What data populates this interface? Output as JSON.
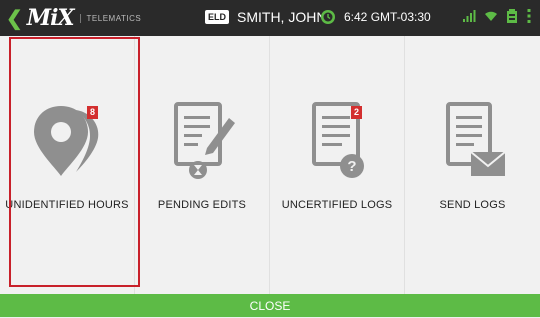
{
  "header": {
    "brand": "MiX",
    "brand_sub": "TELEMATICS",
    "eld_label": "ELD",
    "driver_name": "SMITH, JOHN",
    "time": "6:42 GMT-03:30",
    "status_icon": "clock-icon",
    "system_icons": [
      "signal-icon",
      "wifi-icon",
      "battery-icon",
      "more-icon"
    ]
  },
  "tiles": [
    {
      "label": "UNIDENTIFIED HOURS",
      "badge": "8",
      "icon": "location-pin-icon",
      "selected": true
    },
    {
      "label": "PENDING EDITS",
      "badge": "",
      "icon": "document-edit-icon",
      "selected": false
    },
    {
      "label": "UNCERTIFIED LOGS",
      "badge": "2",
      "icon": "document-question-icon",
      "selected": false
    },
    {
      "label": "SEND LOGS",
      "badge": "",
      "icon": "document-mail-icon",
      "selected": false
    }
  ],
  "footer": {
    "close_label": "CLOSE"
  },
  "colors": {
    "accent": "#5dbb46",
    "badge": "#d32f2f",
    "selection": "#c8202a",
    "icon": "#8f8f8f",
    "topbar": "#2a2a2a"
  }
}
